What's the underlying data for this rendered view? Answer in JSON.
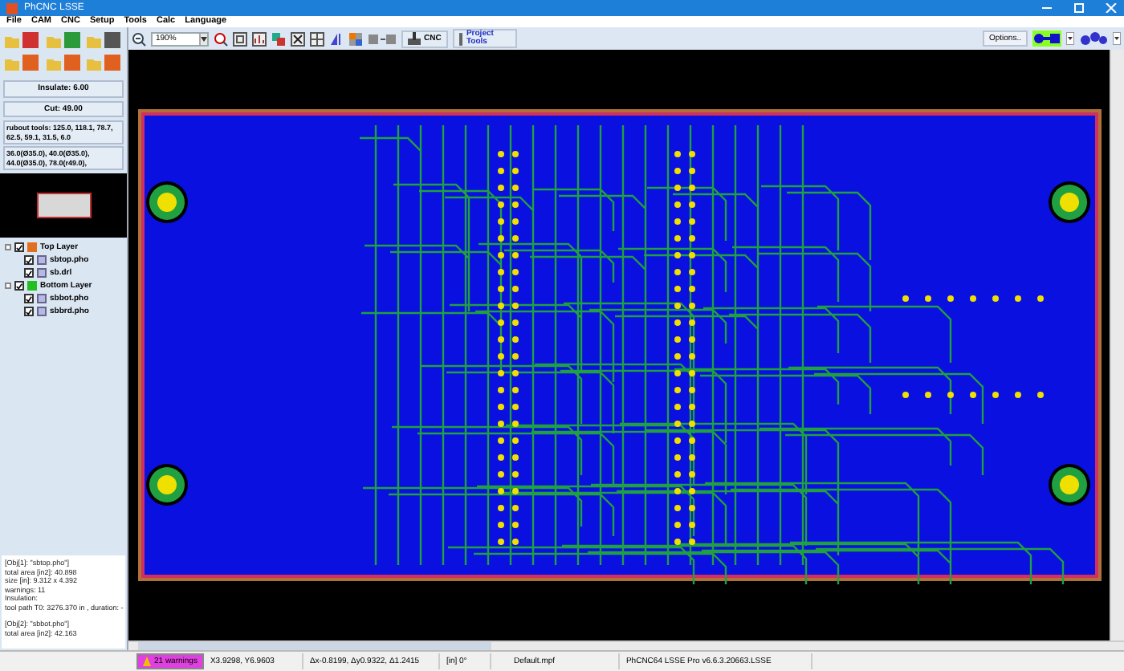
{
  "window": {
    "title": "PhCNC LSSE"
  },
  "menu": [
    "File",
    "CAM",
    "CNC",
    "Setup",
    "Tools",
    "Calc",
    "Language"
  ],
  "toolbar": {
    "zoom": "190%",
    "cnc_button": "CNC",
    "project_button": "Project Tools",
    "options_button": "Options.."
  },
  "left_panel": {
    "insulate_button": "Insulate: 6.00",
    "cut_button": "Cut: 49.00",
    "tool_lists": [
      "rubout tools: 125.0, 118.1, 78.7, 62.5, 59.1, 31.5, 6.0",
      "36.0(Ø35.0), 40.0(Ø35.0), 44.0(Ø35.0), 78.0(r49.0),"
    ],
    "layers": [
      {
        "label": "Top Layer",
        "checked": true,
        "color": "#e07020",
        "children": [
          {
            "label": "sbtop.pho",
            "checked": true
          },
          {
            "label": "sb.drl",
            "checked": true
          }
        ]
      },
      {
        "label": "Bottom Layer",
        "checked": true,
        "color": "#20c020",
        "children": [
          {
            "label": "sbbot.pho",
            "checked": true
          },
          {
            "label": "sbbrd.pho",
            "checked": true
          }
        ]
      }
    ],
    "log": [
      "[Obj[1]: \"sbtop.pho\"]",
      "total area [in2]: 40.898",
      "size [in]: 9.312 x 4.392",
      "warnings: 11",
      "Insulation:",
      "tool path T0: 3276.370 in , duration: -",
      "[Obj[2]: \"sbbot.pho\"]",
      "total area [in2]: 42.163"
    ]
  },
  "status_bar": {
    "warnings": "21 warnings",
    "position": "X3.9298, Y6.9603",
    "delta": "Δx-0.8199, Δy0.9322, Δ1.2415",
    "units": "[in]  0°",
    "file": "Default.mpf",
    "version": "PhCNC64 LSSE Pro v6.6.3.20663.LSSE"
  }
}
